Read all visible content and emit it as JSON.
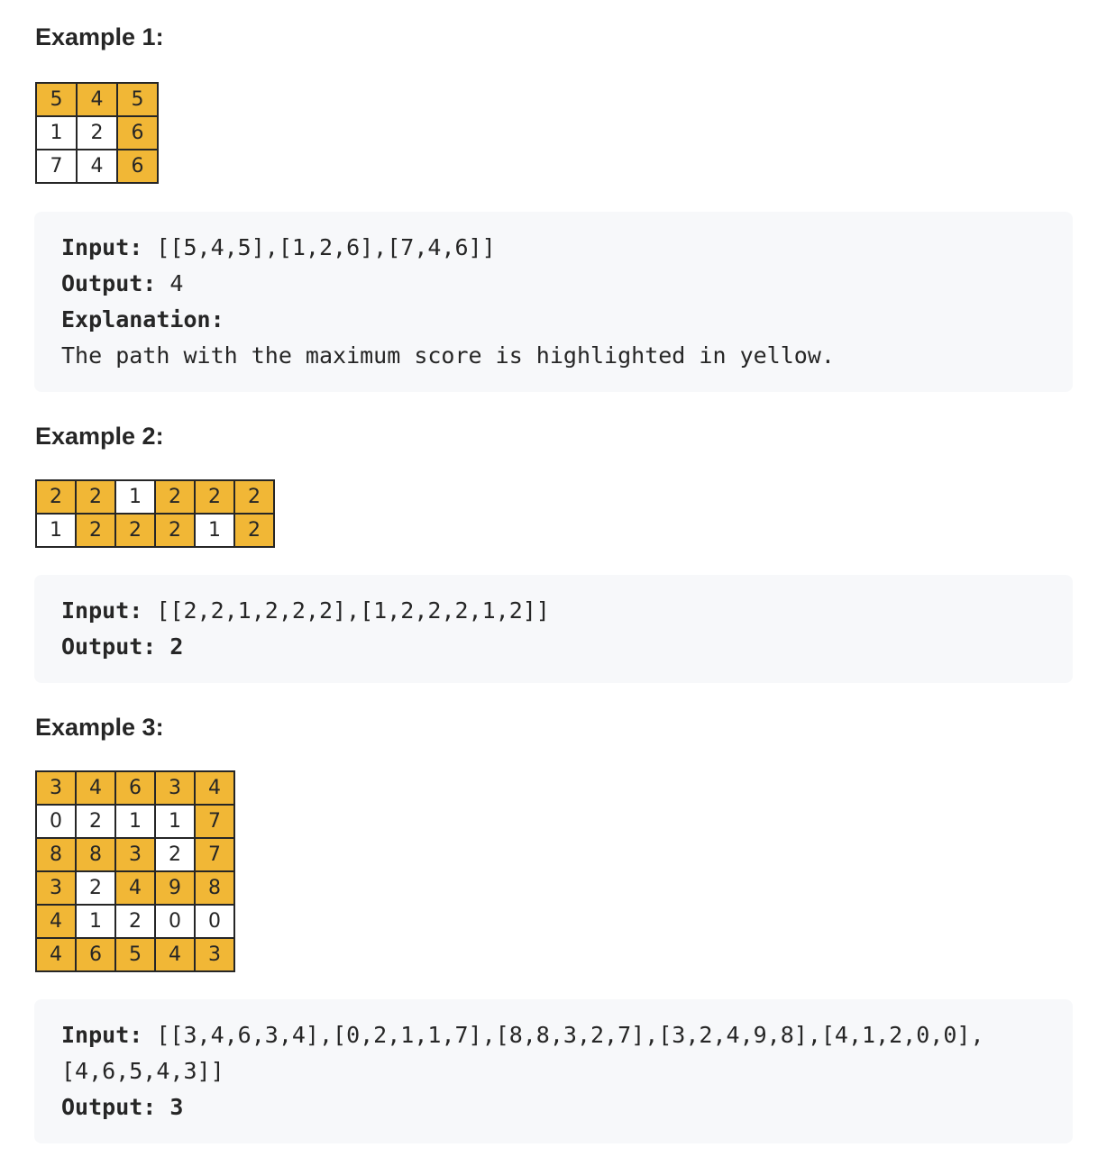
{
  "examples": [
    {
      "heading": "Example 1:",
      "grid": [
        [
          5,
          4,
          5
        ],
        [
          1,
          2,
          6
        ],
        [
          7,
          4,
          6
        ]
      ],
      "highlight": [
        [
          1,
          1,
          1
        ],
        [
          0,
          0,
          1
        ],
        [
          0,
          0,
          1
        ]
      ],
      "input_label": "Input:",
      "input_value": " [[5,4,5],[1,2,6],[7,4,6]]",
      "output_label": "Output:",
      "output_value": " 4",
      "explanation_label": "Explanation:",
      "explanation_text": "The path with the maximum score is highlighted in yellow."
    },
    {
      "heading": "Example 2:",
      "grid": [
        [
          2,
          2,
          1,
          2,
          2,
          2
        ],
        [
          1,
          2,
          2,
          2,
          1,
          2
        ]
      ],
      "highlight": [
        [
          1,
          1,
          0,
          1,
          1,
          1
        ],
        [
          0,
          1,
          1,
          1,
          0,
          1
        ]
      ],
      "input_label": "Input:",
      "input_value": " [[2,2,1,2,2,2],[1,2,2,2,1,2]]",
      "output_label": "Output:",
      "output_value": " 2"
    },
    {
      "heading": "Example 3:",
      "grid": [
        [
          3,
          4,
          6,
          3,
          4
        ],
        [
          0,
          2,
          1,
          1,
          7
        ],
        [
          8,
          8,
          3,
          2,
          7
        ],
        [
          3,
          2,
          4,
          9,
          8
        ],
        [
          4,
          1,
          2,
          0,
          0
        ],
        [
          4,
          6,
          5,
          4,
          3
        ]
      ],
      "highlight": [
        [
          1,
          1,
          1,
          1,
          1
        ],
        [
          0,
          0,
          0,
          0,
          1
        ],
        [
          1,
          1,
          1,
          0,
          1
        ],
        [
          1,
          0,
          1,
          1,
          1
        ],
        [
          1,
          0,
          0,
          0,
          0
        ],
        [
          1,
          1,
          1,
          1,
          1
        ]
      ],
      "input_label": "Input:",
      "input_value": " [[3,4,6,3,4],[0,2,1,1,7],[8,8,3,2,7],[3,2,4,9,8],[4,1,2,0,0],[4,6,5,4,3]]",
      "output_label": "Output:",
      "output_value": " 3"
    }
  ],
  "colors": {
    "highlight": "#f1b736",
    "code_background": "#f7f8fa"
  }
}
